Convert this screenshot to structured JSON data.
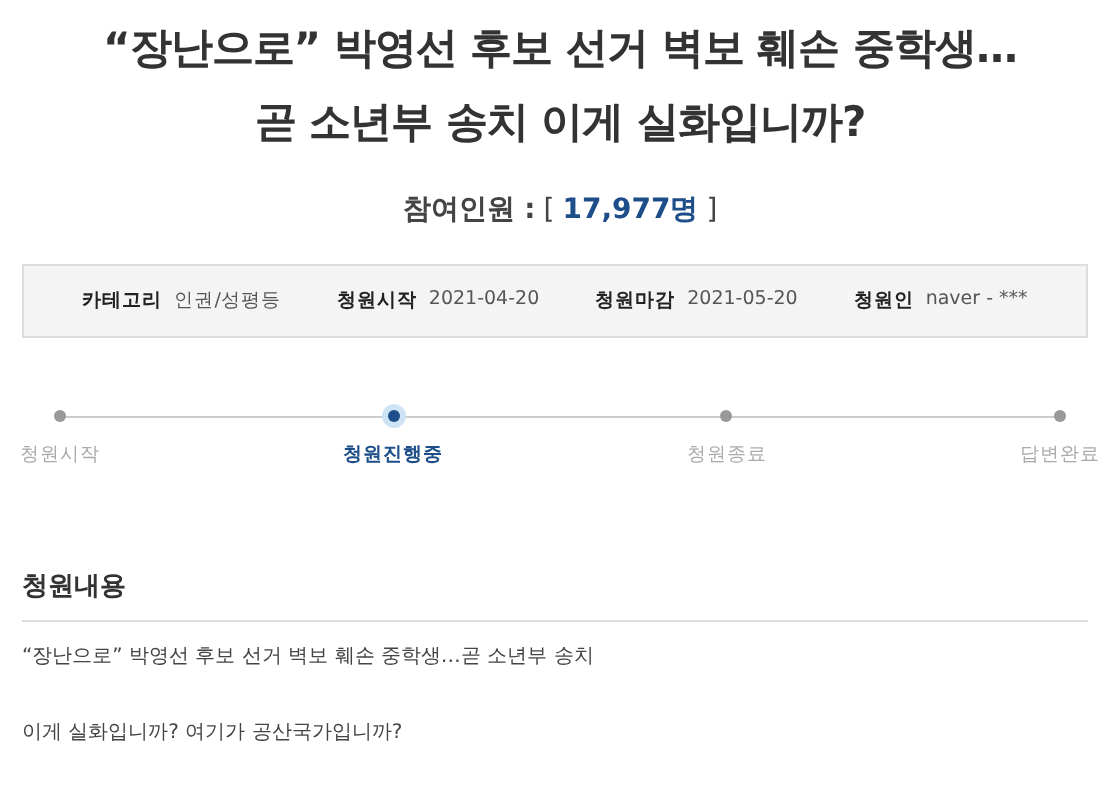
{
  "title": "“장난으로” 박영선 후보 선거 벽보 훼손 중학생…곧 소년부 송치 이게 실화입니까?",
  "participants": {
    "label": "참여인원 :",
    "open": "[",
    "count": "17,977명",
    "close": "]"
  },
  "info": [
    {
      "label": "카테고리",
      "value": "인권/성평등"
    },
    {
      "label": "청원시작",
      "value": "2021-04-20"
    },
    {
      "label": "청원마감",
      "value": "2021-05-20"
    },
    {
      "label": "청원인",
      "value": "naver - ***"
    }
  ],
  "steps": [
    {
      "label": "청원시작",
      "selected": false
    },
    {
      "label": "청원진행중",
      "selected": true
    },
    {
      "label": "청원종료",
      "selected": false
    },
    {
      "label": "답변완료",
      "selected": false
    }
  ],
  "content": {
    "heading": "청원내용",
    "paragraphs": [
      "“장난으로” 박영선 후보 선거 벽보 훼손 중학생…곧 소년부 송치",
      "이게 실화입니까? 여기가 공산국가입니까?"
    ]
  }
}
